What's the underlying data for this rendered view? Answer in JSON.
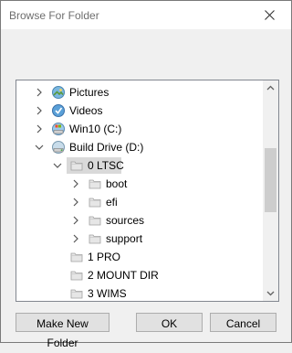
{
  "window": {
    "title": "Browse For Folder"
  },
  "tree": {
    "items": [
      {
        "label": "Pictures",
        "icon": "pictures-icon",
        "expander": "collapsed"
      },
      {
        "label": "Videos",
        "icon": "videos-icon",
        "expander": "collapsed"
      },
      {
        "label": "Win10 (C:)",
        "icon": "drive-icon",
        "expander": "collapsed"
      },
      {
        "label": "Build Drive (D:)",
        "icon": "drive-icon",
        "expander": "expanded"
      },
      {
        "label": "0 LTSC",
        "icon": "folder-icon",
        "expander": "expanded",
        "selected": true
      },
      {
        "label": "boot",
        "icon": "folder-icon",
        "expander": "collapsed"
      },
      {
        "label": "efi",
        "icon": "folder-icon",
        "expander": "collapsed"
      },
      {
        "label": "sources",
        "icon": "folder-icon",
        "expander": "collapsed"
      },
      {
        "label": "support",
        "icon": "folder-icon",
        "expander": "collapsed"
      },
      {
        "label": "1 PRO",
        "icon": "folder-icon",
        "expander": "none"
      },
      {
        "label": "2 MOUNT DIR",
        "icon": "folder-icon",
        "expander": "none"
      },
      {
        "label": "3 WIMS",
        "icon": "folder-icon",
        "expander": "none"
      }
    ]
  },
  "buttons": {
    "make_new_folder": "Make New Folder",
    "ok": "OK",
    "cancel": "Cancel"
  },
  "colors": {
    "selection": "#d9d9d9",
    "folder": "#dcdcdc",
    "border": "#828790"
  }
}
